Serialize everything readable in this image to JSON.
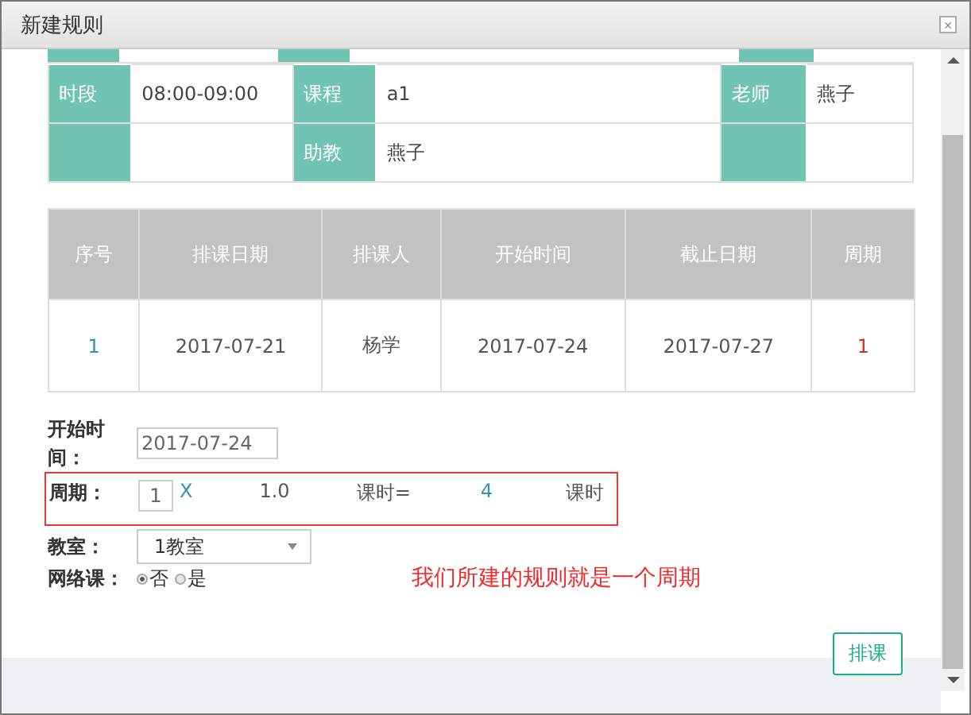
{
  "dialog": {
    "title": "新建规则",
    "close": "×"
  },
  "info_table": {
    "rows": [
      {
        "cells": [
          {
            "kind": "label",
            "text": "时段"
          },
          {
            "kind": "value",
            "text": "08:00-09:00"
          },
          {
            "kind": "label",
            "text": "课程"
          },
          {
            "kind": "value",
            "text": "a1"
          },
          {
            "kind": "label",
            "text": "老师"
          },
          {
            "kind": "value",
            "text": "燕子"
          }
        ]
      },
      {
        "cells": [
          {
            "kind": "label",
            "text": ""
          },
          {
            "kind": "value",
            "text": ""
          },
          {
            "kind": "label",
            "text": "助教"
          },
          {
            "kind": "value",
            "text": "燕子"
          },
          {
            "kind": "label",
            "text": ""
          },
          {
            "kind": "value",
            "text": ""
          }
        ]
      }
    ]
  },
  "schedule_table": {
    "columns": [
      "序号",
      "排课日期",
      "排课人",
      "开始时间",
      "截止日期",
      "周期"
    ],
    "rows": [
      [
        "1",
        "2017-07-21",
        "杨学",
        "2017-07-24",
        "2017-07-27",
        "1"
      ]
    ]
  },
  "form": {
    "start_label": "开始时间：",
    "start_value": "2017-07-24",
    "period": {
      "label": "周期：",
      "count": "1",
      "times": "X",
      "hours": "1.0",
      "equals": "课时=",
      "total": "4",
      "unit": "课时",
      "highlighted": true
    },
    "room": {
      "label": "教室：",
      "value": "1教室"
    },
    "online": {
      "label": "网络课：",
      "options": [
        {
          "label": "否",
          "selected": true
        },
        {
          "label": "是",
          "selected": false
        }
      ]
    }
  },
  "annotation": "我们所建的规则就是一个周期",
  "submit_button": "排课"
}
